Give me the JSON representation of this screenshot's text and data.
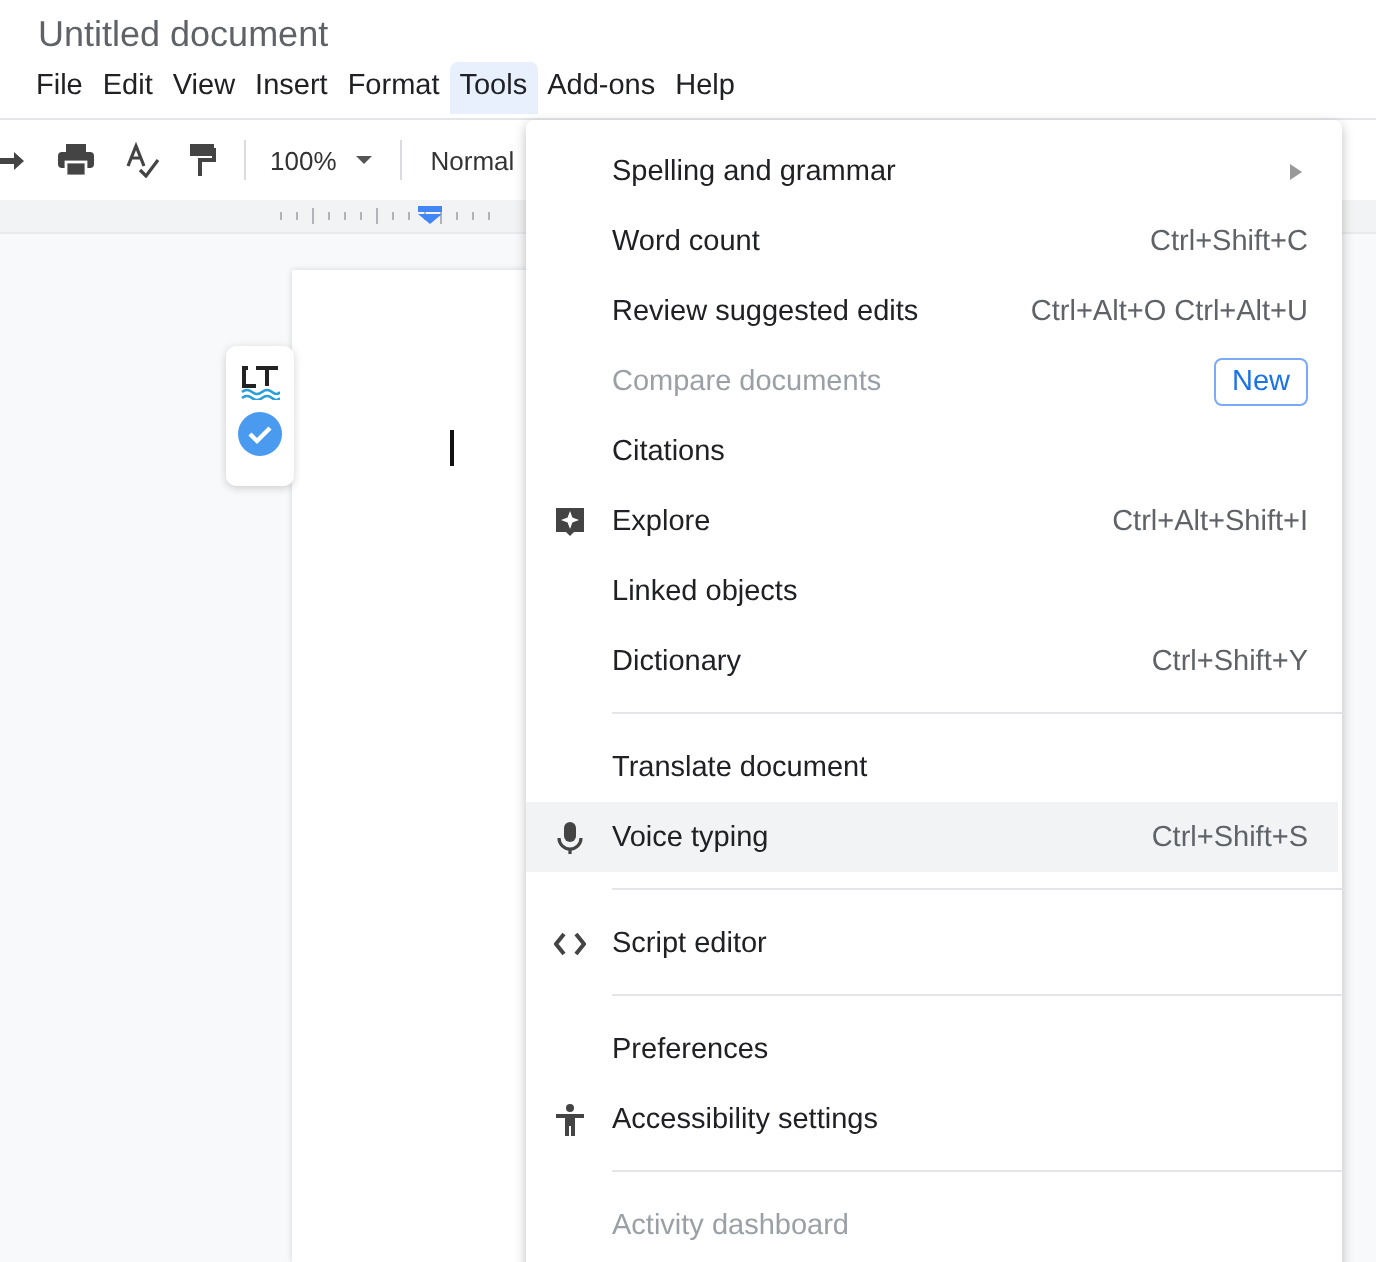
{
  "document": {
    "title": "Untitled document"
  },
  "menu_bar": [
    {
      "label": "File",
      "selected": false
    },
    {
      "label": "Edit",
      "selected": false
    },
    {
      "label": "View",
      "selected": false
    },
    {
      "label": "Insert",
      "selected": false
    },
    {
      "label": "Format",
      "selected": false
    },
    {
      "label": "Tools",
      "selected": true
    },
    {
      "label": "Add-ons",
      "selected": false
    },
    {
      "label": "Help",
      "selected": false
    }
  ],
  "toolbar": {
    "zoom": "100%",
    "style": "Normal"
  },
  "tools_menu": [
    {
      "kind": "submenu",
      "label": "Spelling and grammar",
      "disabled": false,
      "highlighted": false
    },
    {
      "kind": "item",
      "label": "Word count",
      "shortcut": "Ctrl+Shift+C",
      "disabled": false,
      "highlighted": false
    },
    {
      "kind": "item",
      "label": "Review suggested edits",
      "shortcut": "Ctrl+Alt+O Ctrl+Alt+U",
      "disabled": false,
      "highlighted": false
    },
    {
      "kind": "item",
      "label": "Compare documents",
      "badge": "New",
      "disabled": true,
      "highlighted": false
    },
    {
      "kind": "item",
      "label": "Citations",
      "disabled": false,
      "highlighted": false
    },
    {
      "kind": "item",
      "label": "Explore",
      "shortcut": "Ctrl+Alt+Shift+I",
      "disabled": false,
      "highlighted": false
    },
    {
      "kind": "item",
      "label": "Linked objects",
      "disabled": false,
      "highlighted": false
    },
    {
      "kind": "item",
      "label": "Dictionary",
      "shortcut": "Ctrl+Shift+Y",
      "disabled": false,
      "highlighted": false
    },
    {
      "kind": "separator"
    },
    {
      "kind": "item",
      "label": "Translate document",
      "disabled": false,
      "highlighted": false
    },
    {
      "kind": "item",
      "label": "Voice typing",
      "shortcut": "Ctrl+Shift+S",
      "disabled": false,
      "highlighted": true
    },
    {
      "kind": "separator"
    },
    {
      "kind": "item",
      "label": "Script editor",
      "disabled": false,
      "highlighted": false
    },
    {
      "kind": "separator"
    },
    {
      "kind": "item",
      "label": "Preferences",
      "disabled": false,
      "highlighted": false
    },
    {
      "kind": "item",
      "label": "Accessibility settings",
      "disabled": false,
      "highlighted": false
    },
    {
      "kind": "separator"
    },
    {
      "kind": "item",
      "label": "Activity dashboard",
      "disabled": true,
      "highlighted": false
    }
  ]
}
